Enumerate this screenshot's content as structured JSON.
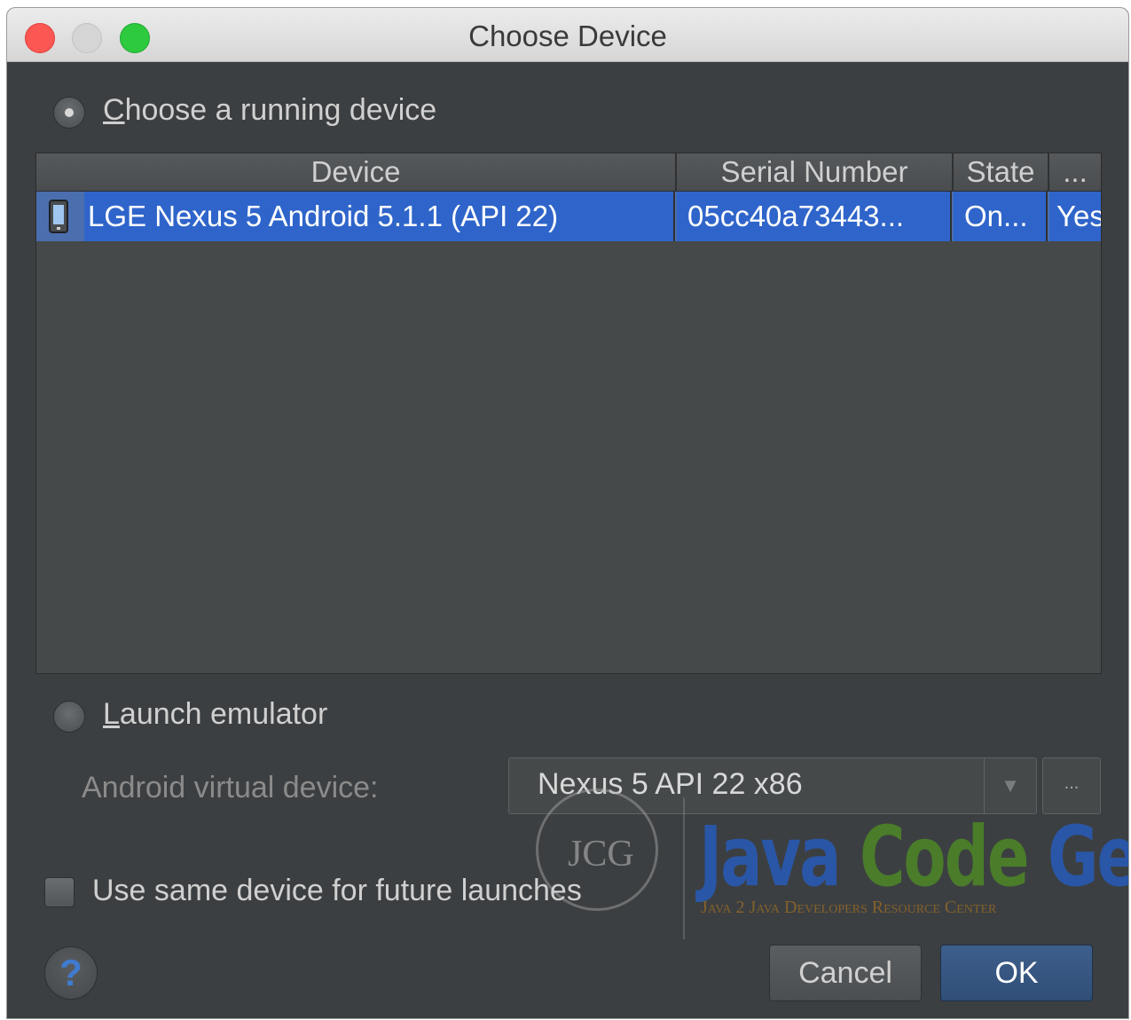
{
  "window": {
    "title": "Choose Device"
  },
  "running": {
    "label_prefix": "C",
    "label_rest": "hoose a running device"
  },
  "table": {
    "columns": [
      "Device",
      "Serial Number",
      "State",
      "..."
    ],
    "rows": [
      {
        "device": "LGE Nexus 5 Android 5.1.1 (API 22)",
        "serial": "05cc40a73443...",
        "state": "On...",
        "extra": "Yes"
      }
    ]
  },
  "emulator": {
    "label_prefix": "L",
    "label_rest": "aunch emulator",
    "avd_label": "Android virtual device:",
    "avd_value": "Nexus 5 API 22 x86",
    "more_label": "..."
  },
  "future": {
    "label": "Use same device for future launches"
  },
  "buttons": {
    "help": "?",
    "cancel": "Cancel",
    "ok": "OK"
  },
  "watermark": {
    "circle_text": "JCG",
    "java": "Java",
    "code": "Code",
    "geeks": "Geeks",
    "tagline": "Java 2 Java Developers Resource Center"
  },
  "colors": {
    "selection": "#2f65ca",
    "panel": "#3c3f41",
    "close": "#fc5753",
    "maximize": "#2dc93f"
  }
}
